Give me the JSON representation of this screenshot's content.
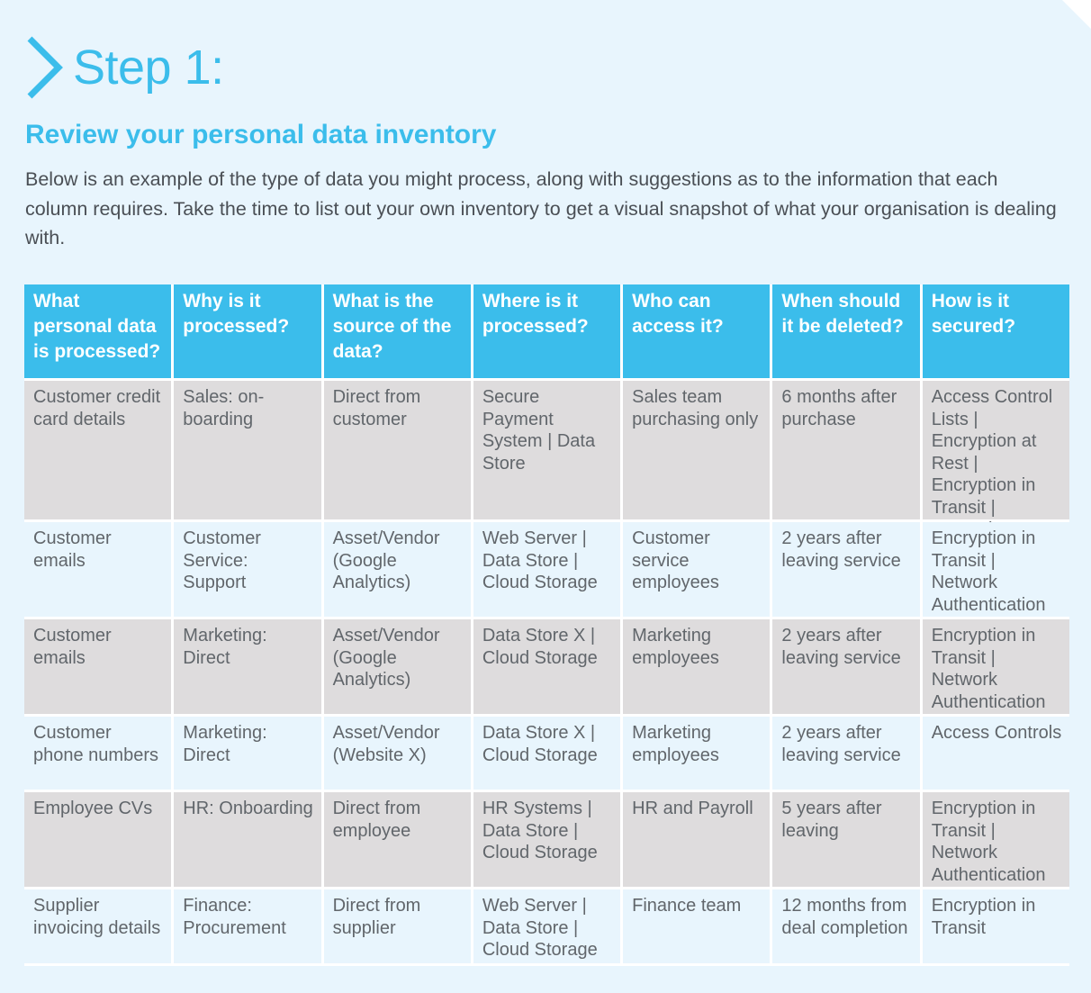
{
  "step": {
    "icon": "chevron-right-icon",
    "title": "Step 1:"
  },
  "subtitle": "Review your personal data inventory",
  "intro": "Below is an example of the type of data you might process, along with suggestions as to the information that each column requires. Take the time to list out your own inventory to get a visual snapshot of what your organisation is dealing with.",
  "colors": {
    "accent": "#3bbdeb",
    "background": "#e8f5fd",
    "row_gray": "#dedcdd",
    "text": "#61666b"
  },
  "table": {
    "headers": [
      "What personal data is processed?",
      "Why is it processed?",
      "What is the source of the data?",
      "Where is it processed?",
      "Who can access it?",
      "When should it be deleted?",
      "How is it secured?"
    ],
    "rows": [
      [
        "Customer credit card details",
        "Sales: on-boarding",
        "Direct from customer",
        "Secure Payment System | Data Store",
        "Sales team purchasing only",
        "6 months after purchase",
        "Access Control Lists | Encryption at Rest | Encryption in Transit | Network Authentication"
      ],
      [
        "Customer emails",
        "Customer Service: Support",
        "Asset/Vendor (Google Analytics)",
        "Web Server | Data Store | Cloud Storage",
        "Customer service employees",
        "2 years after leaving service",
        "Encryption in Transit | Network Authentication"
      ],
      [
        "Customer emails",
        "Marketing: Direct",
        "Asset/Vendor (Google Analytics)",
        "Data Store X | Cloud Storage",
        "Marketing employees",
        "2 years after leaving service",
        "Encryption in Transit | Network Authentication"
      ],
      [
        "Customer phone numbers",
        "Marketing: Direct",
        "Asset/Vendor (Website X)",
        "Data Store X | Cloud Storage",
        "Marketing employees",
        "2 years after leaving service",
        "Access Controls"
      ],
      [
        "Employee CVs",
        "HR: Onboarding",
        "Direct from employee",
        "HR Systems | Data Store | Cloud Storage",
        "HR and Payroll",
        "5 years after leaving",
        "Encryption in Transit | Network Authentication"
      ],
      [
        "Supplier invoicing details",
        "Finance: Procurement",
        "Direct from supplier",
        "Web Server | Data Store | Cloud Storage",
        "Finance team",
        "12 months from deal completion",
        "Encryption in Transit"
      ]
    ]
  }
}
